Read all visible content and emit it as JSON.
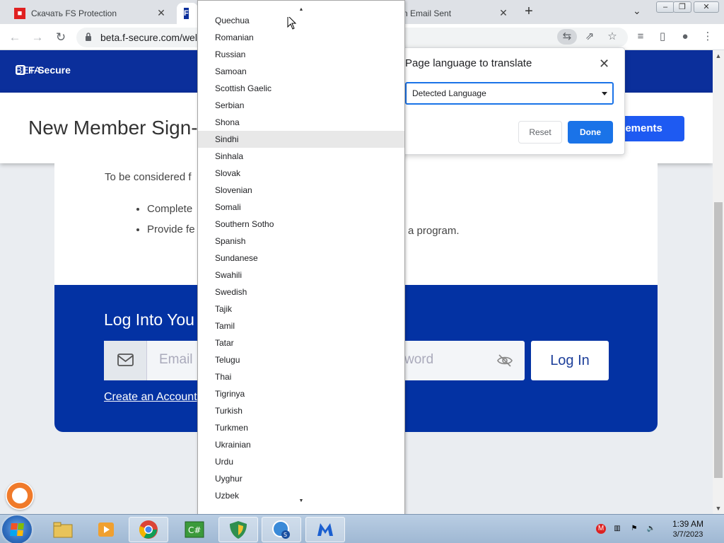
{
  "browser": {
    "tabs": [
      {
        "title": "Скачать FS Protection",
        "favicon": "fs-red"
      },
      {
        "title": "",
        "favicon": "fsecure-blue"
      },
      {
        "title": "n Email Sent",
        "favicon": "none"
      }
    ],
    "url": "beta.f-secure.com/wel"
  },
  "page": {
    "logo_text": "F-Secure",
    "logo_sub": "BETA",
    "title": "New Member Sign-",
    "agreements_button": "eements",
    "intro_text": "To be considered f",
    "bullets": [
      "Complete",
      "Provide fe"
    ],
    "bullet_tail": "a program.",
    "login_title": "Log Into You",
    "email_placeholder": "Email",
    "password_placeholder": "word",
    "login_button": "Log In",
    "create_account_link": "Create an Account"
  },
  "translate_bubble": {
    "title": "Page language to translate",
    "selected_language": "Detected Language",
    "reset_label": "Reset",
    "done_label": "Done"
  },
  "language_dropdown": {
    "highlighted": "Sindhi",
    "items": [
      "Quechua",
      "Romanian",
      "Russian",
      "Samoan",
      "Scottish Gaelic",
      "Serbian",
      "Shona",
      "Sindhi",
      "Sinhala",
      "Slovak",
      "Slovenian",
      "Somali",
      "Southern Sotho",
      "Spanish",
      "Sundanese",
      "Swahili",
      "Swedish",
      "Tajik",
      "Tamil",
      "Tatar",
      "Telugu",
      "Thai",
      "Tigrinya",
      "Turkish",
      "Turkmen",
      "Ukrainian",
      "Urdu",
      "Uyghur",
      "Uzbek"
    ]
  },
  "taskbar": {
    "time": "1:39 AM",
    "date": "3/7/2023"
  },
  "colors": {
    "brand_blue": "#0b2f9b",
    "login_blue": "#0332a3",
    "chrome_blue": "#1a73e8"
  }
}
